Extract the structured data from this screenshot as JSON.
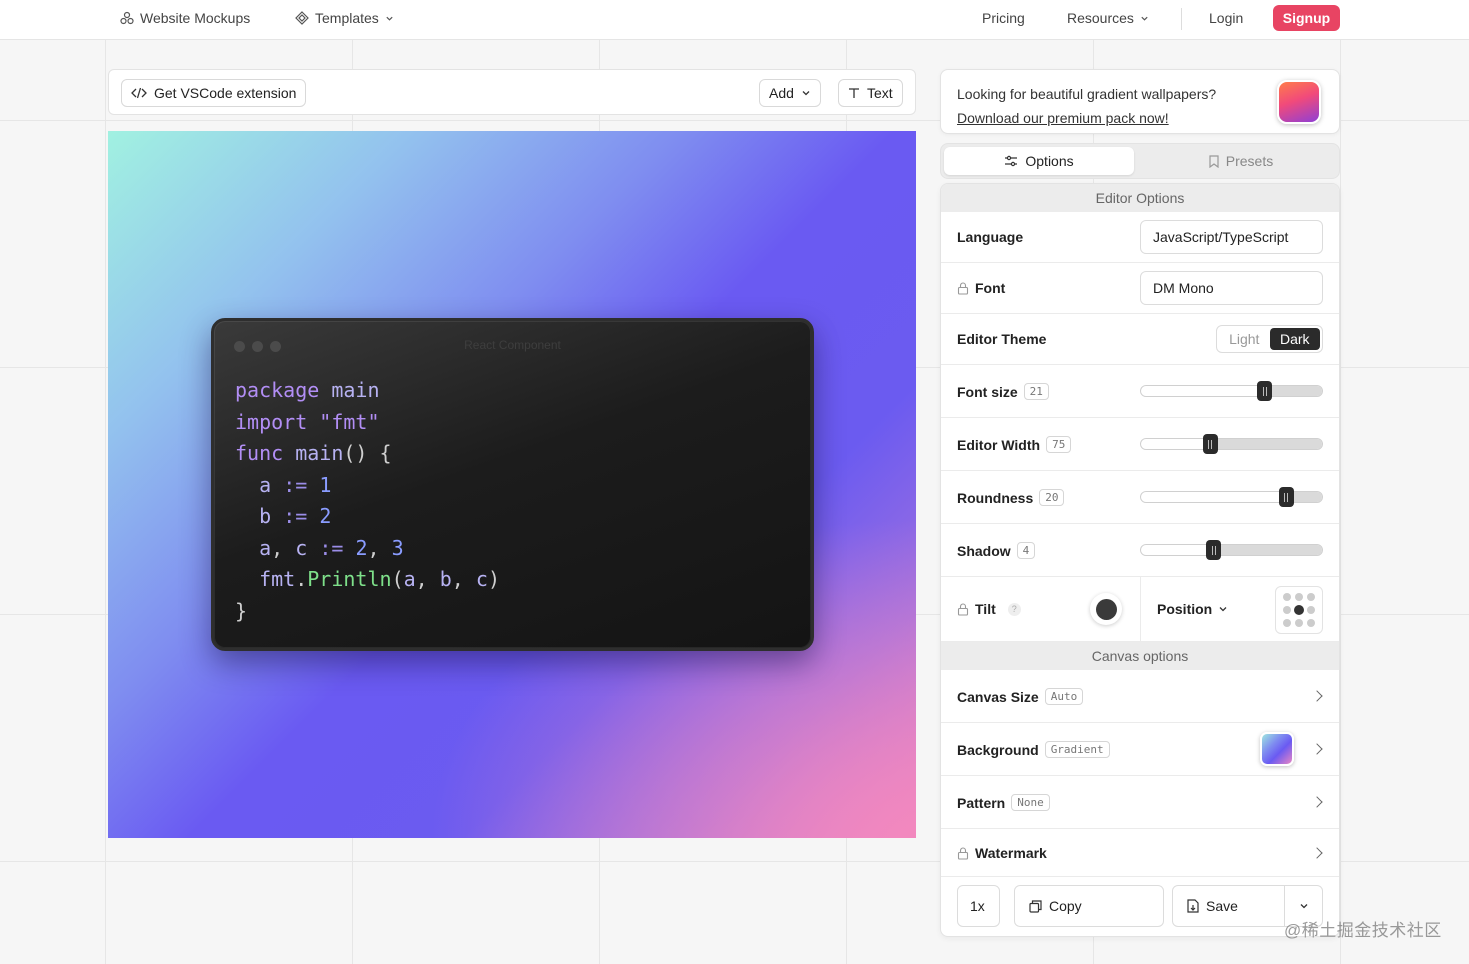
{
  "nav": {
    "website_mockups": "Website Mockups",
    "templates": "Templates",
    "pricing": "Pricing",
    "resources": "Resources",
    "login": "Login",
    "signup": "Signup"
  },
  "toolbar": {
    "vscode": "Get VSCode extension",
    "add": "Add",
    "text": "Text"
  },
  "window": {
    "title": "React Component",
    "code": {
      "l1_kw": "package",
      "l1_id": "main",
      "l2_kw": "import",
      "l2_str": "\"fmt\"",
      "l3_kw": "func",
      "l3_id": "main",
      "l3_rest": "() {",
      "l4_a": "a",
      "l4_op": ":=",
      "l4_n": "1",
      "l5_b": "b",
      "l5_op": ":=",
      "l5_n": "2",
      "l6_a": "a",
      "l6_c": "c",
      "l6_op": ":=",
      "l6_n1": "2",
      "l6_n2": "3",
      "l7_pkg": "fmt",
      "l7_fn": "Println",
      "l7_a": "a",
      "l7_b": "b",
      "l7_c": "c",
      "l8": "}"
    }
  },
  "promo": {
    "line1": "Looking for beautiful gradient wallpapers?",
    "link": "Download our premium pack now!"
  },
  "tabs": {
    "options": "Options",
    "presets": "Presets"
  },
  "editor": {
    "heading": "Editor Options",
    "language_label": "Language",
    "language_value": "JavaScript/TypeScript",
    "font_label": "Font",
    "font_value": "DM Mono",
    "theme_label": "Editor Theme",
    "theme_light": "Light",
    "theme_dark": "Dark",
    "font_size_label": "Font size",
    "font_size_value": "21",
    "font_size_pct": 0.68,
    "editor_width_label": "Editor Width",
    "editor_width_value": "75",
    "editor_width_pct": 0.38,
    "roundness_label": "Roundness",
    "roundness_value": "20",
    "roundness_pct": 0.8,
    "shadow_label": "Shadow",
    "shadow_value": "4",
    "shadow_pct": 0.4,
    "tilt_label": "Tilt",
    "tilt_help": "?",
    "position_label": "Position"
  },
  "canvas": {
    "heading": "Canvas options",
    "size_label": "Canvas Size",
    "size_value": "Auto",
    "background_label": "Background",
    "background_value": "Gradient",
    "pattern_label": "Pattern",
    "pattern_value": "None",
    "watermark_label": "Watermark"
  },
  "footer": {
    "scale": "1x",
    "copy": "Copy",
    "save": "Save"
  },
  "site_watermark": "@稀土掘金技术社区",
  "colors": {
    "accent": "#e84463",
    "dark": "#2b2b2b"
  }
}
